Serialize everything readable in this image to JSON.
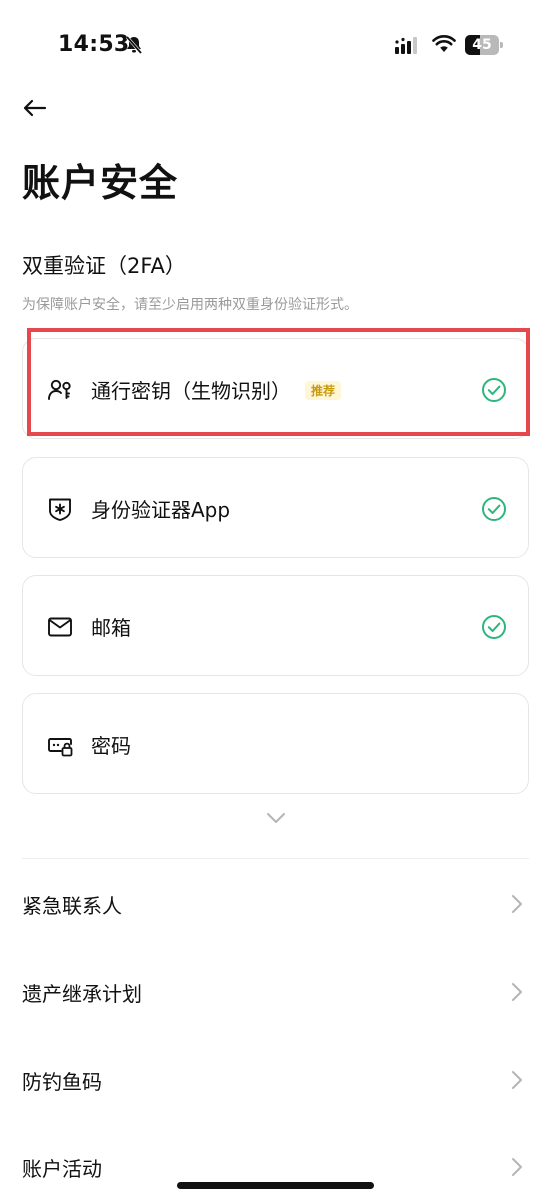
{
  "status_bar": {
    "time": "14:53",
    "battery_level": "45",
    "battery_fraction": 0.45
  },
  "header": {
    "title": "账户安全"
  },
  "two_factor": {
    "title": "双重验证（2FA）",
    "description": "为保障账户安全，请至少启用两种双重身份验证形式。",
    "methods": [
      {
        "label": "通行密钥（生物识别）",
        "badge": "推荐",
        "icon": "passkey-person-key-icon",
        "enabled": true
      },
      {
        "label": "身份验证器App",
        "icon": "authenticator-shield-icon",
        "enabled": true
      },
      {
        "label": "邮箱",
        "icon": "envelope-icon",
        "enabled": true
      },
      {
        "label": "密码",
        "icon": "password-lock-icon",
        "enabled": false
      }
    ]
  },
  "menu": {
    "items": [
      {
        "label": "紧急联系人"
      },
      {
        "label": "遗产继承计划"
      },
      {
        "label": "防钓鱼码"
      },
      {
        "label": "账户活动"
      }
    ]
  },
  "colors": {
    "check": "#2db67c",
    "highlight": "#e5484d",
    "badge_text": "#c99a10",
    "badge_bg": "#fff6d6"
  }
}
